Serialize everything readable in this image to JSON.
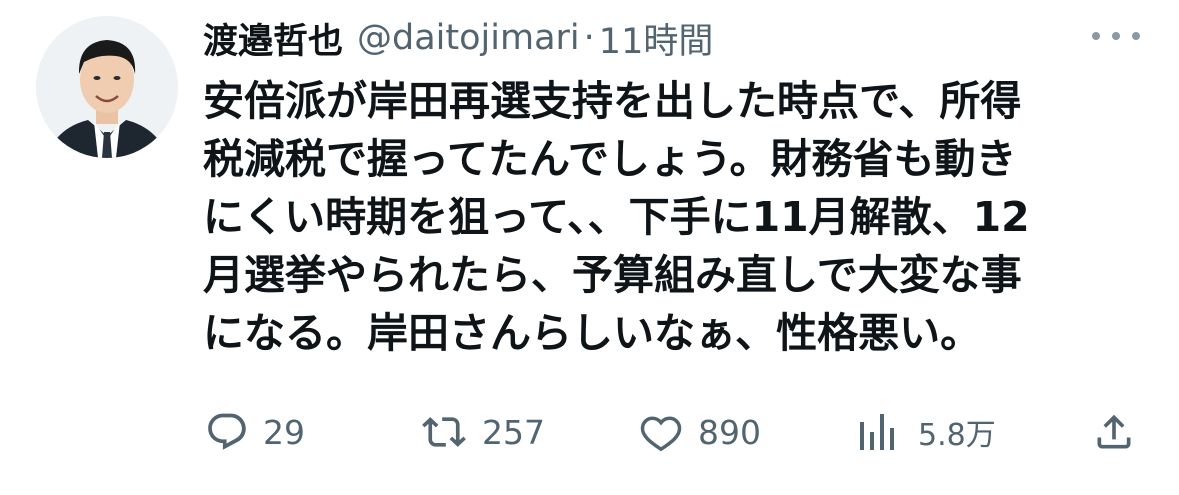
{
  "author": {
    "display_name": "渡邉哲也",
    "handle": "@daitojimari",
    "separator": "·",
    "time": "11時間"
  },
  "tweet": {
    "lines": [
      "安倍派が岸田再選支持を出した時点で、所得",
      "税減税で握ってたんでしょう。財務省も動き",
      "にくい時期を狙って、、下手に11月解散、12",
      "月選挙やられたら、予算組み直しで大変な事",
      "になる。岸田さんらしいなぁ、性格悪い。"
    ]
  },
  "actions": {
    "replies": "29",
    "retweets": "257",
    "likes": "890",
    "views": "5.8万"
  },
  "icons": {
    "more": "more-dots-icon",
    "reply": "reply-icon",
    "retweet": "retweet-icon",
    "like": "heart-icon",
    "views": "bar-chart-icon",
    "share": "share-icon"
  },
  "colors": {
    "text": "#0f1419",
    "secondary": "#536471",
    "background": "#ffffff"
  }
}
